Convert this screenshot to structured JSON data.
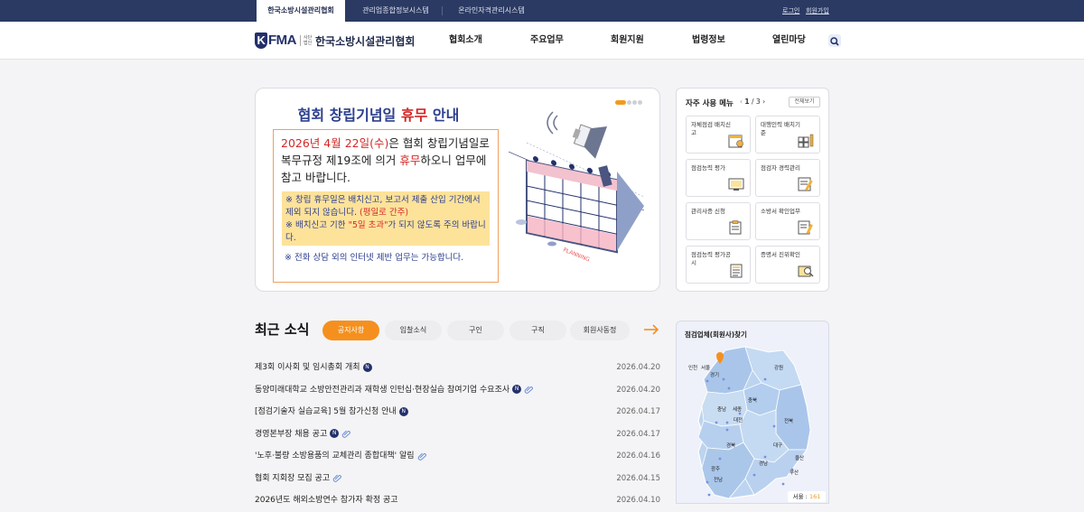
{
  "topbar": {
    "tabs": [
      "한국소방시설관리협회",
      "관리업종합정보시스템",
      "온라인자격관리시스템"
    ],
    "login": "로그인",
    "signup": "회원가입"
  },
  "header": {
    "logo_mark": "KFMA",
    "logo_small": "사단법인",
    "logo_name": "한국소방시설관리협회",
    "menu": [
      "협회소개",
      "주요업무",
      "회원지원",
      "법령정보",
      "열린마당"
    ]
  },
  "banner": {
    "title_pre": "협회 창립기념일 ",
    "title_red": "휴무",
    "title_post": " 안내",
    "lead_red": "2026년 4월 22일(수)",
    "lead_mid": "은 협회 창립기념일로 복무규정 제19조에 의거 ",
    "lead_red2": "휴무",
    "lead_post": "하오니 업무에 참고 바랍니다.",
    "note1_pre": "※ 창립 휴무일은 배치신고, 보고서 제출 산입 기간에서 제외 되지 않습니다. ",
    "note1_red": "(평일로 간주)",
    "note2_pre": "※ 배치신고 기한 ",
    "note2_red": "\"5일 초과\"",
    "note2_post": "가 되지 않도록 주의 바랍니다.",
    "tel": "※ 전화 상담 외의 인터넷 제반 업무는 가능합니다.",
    "illustration_text": "PLANNING"
  },
  "quick": {
    "title": "자주 사용 메뉴",
    "page_current": "1",
    "page_sep": "/",
    "page_total": "3",
    "view_all": "전체보기",
    "items": [
      {
        "label": "자체점검 배치신고",
        "icon": "calendar-icon"
      },
      {
        "label": "대행인력 배치기준",
        "icon": "grid-pencil-icon"
      },
      {
        "label": "점검능력 평가",
        "icon": "monitor-icon"
      },
      {
        "label": "점검자 경력관리",
        "icon": "note-pen-icon"
      },
      {
        "label": "관리사증 신청",
        "icon": "clipboard-icon"
      },
      {
        "label": "소방서 확인업무",
        "icon": "document-pen-icon"
      },
      {
        "label": "점검능력 평가공시",
        "icon": "list-document-icon"
      },
      {
        "label": "증명서 진위확인",
        "icon": "certificate-search-icon"
      }
    ]
  },
  "news": {
    "title": "최근 소식",
    "tabs": [
      "공지사항",
      "입찰소식",
      "구인",
      "구직",
      "회원사동정"
    ],
    "items": [
      {
        "title": "제3회 이사회 및 임시총회 개최",
        "date": "2026.04.20",
        "new": true,
        "clip": false
      },
      {
        "title": "동양미래대학교 소방안전관리과 재학생 인턴십·현장실습 참여기업 수요조사",
        "date": "2026.04.20",
        "new": true,
        "clip": true
      },
      {
        "title": "[점검기술자 실습교육] 5월 참가신청 안내",
        "date": "2026.04.17",
        "new": true,
        "clip": false
      },
      {
        "title": "경영본부장 채용 공고",
        "date": "2026.04.17",
        "new": true,
        "clip": true
      },
      {
        "title": "'노후·불량 소방용품의 교체관리 종합대책' 알림",
        "date": "2026.04.16",
        "new": false,
        "clip": true
      },
      {
        "title": "협회 지회장 모집 공고",
        "date": "2026.04.15",
        "new": false,
        "clip": true
      },
      {
        "title": "2026년도 해외소방연수 참가자 확정 공고",
        "date": "2026.04.10",
        "new": false,
        "clip": false
      }
    ],
    "new_badge": "N"
  },
  "map": {
    "title": "점검업체(회원사)찾기",
    "regions": [
      "인천",
      "서울",
      "경기",
      "강원",
      "충북",
      "충남",
      "세종",
      "대전",
      "경북",
      "전북",
      "대구",
      "울산",
      "경남",
      "부산",
      "광주",
      "전남"
    ],
    "status_label": "서울 : ",
    "status_count": "161"
  },
  "colors": {
    "navy": "#2b3a63",
    "accent": "#f5901e",
    "title_blue": "#2d3f8f",
    "red": "#d42828"
  }
}
